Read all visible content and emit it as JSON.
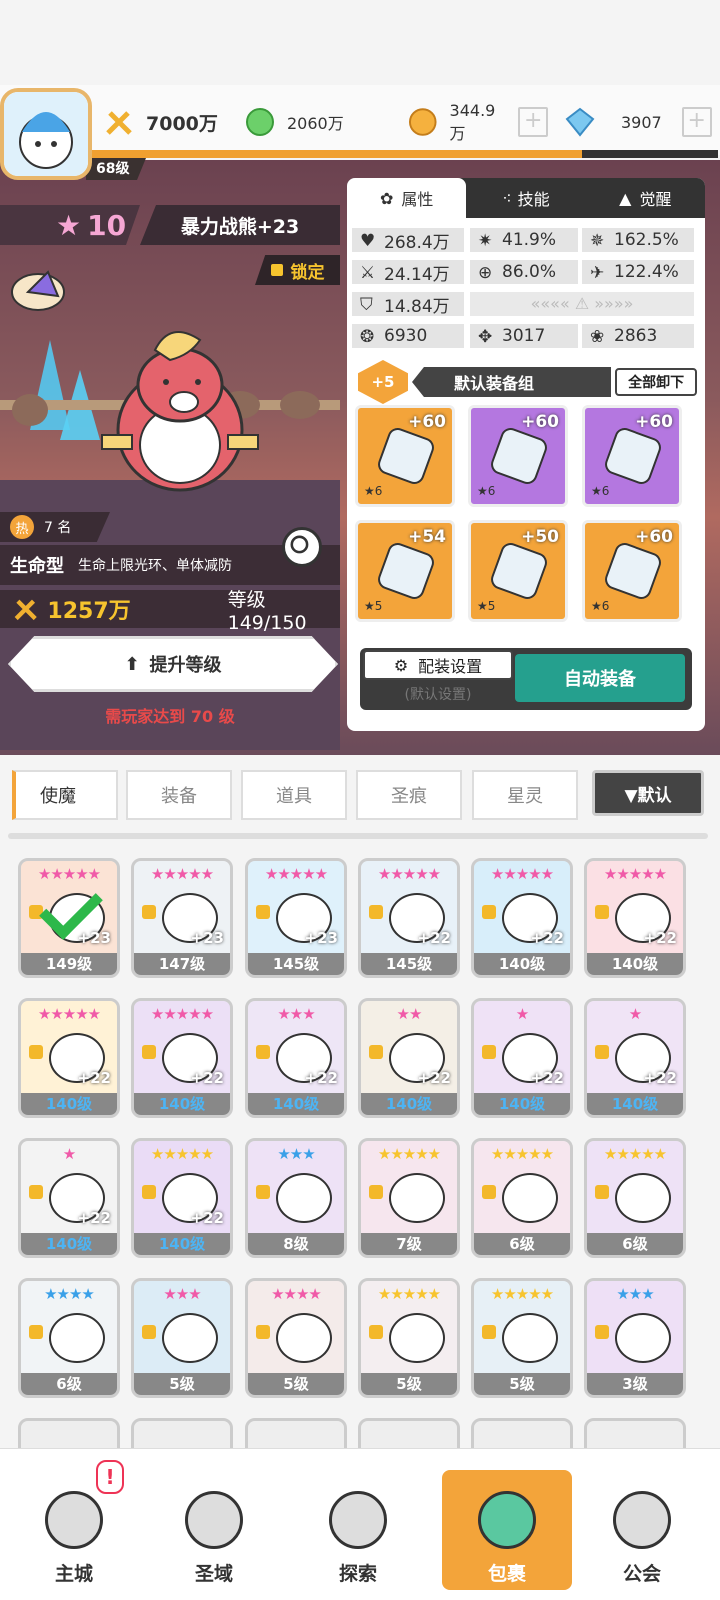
{
  "topbar": {
    "player_level": "68级",
    "power": "7000万",
    "green_currency": "2060万",
    "gold_currency": "344.9万",
    "gem_currency": "3907"
  },
  "hero": {
    "star_count": "10",
    "name": "暴力战熊+23",
    "lock_label": "锁定",
    "rank_label": "热",
    "rank_value": "7 名",
    "type": "生命型",
    "type_desc": "生命上限光环、单体减防",
    "power": "1257万",
    "level_label": "等级 149/150",
    "upgrade_button": "提升等级",
    "requirement": "需玩家达到 70 级"
  },
  "panel": {
    "tabs": [
      "属性",
      "技能",
      "觉醒"
    ],
    "stats": {
      "hp": "268.4万",
      "crit": "41.9%",
      "crit_dmg": "162.5%",
      "atk": "24.14万",
      "hit": "86.0%",
      "speed": "122.4%",
      "def": "14.84万",
      "s1": "6930",
      "s2": "3017",
      "s3": "2863"
    },
    "equip_plus": "+5",
    "equip_set": "默认装备组",
    "unload_all": "全部卸下",
    "equipment": [
      {
        "bonus": "+60",
        "star": "★6",
        "rarity": "orange",
        "icon": "sword-icon"
      },
      {
        "bonus": "+60",
        "star": "★6",
        "rarity": "purple",
        "icon": "helmet-icon"
      },
      {
        "bonus": "+60",
        "star": "★6",
        "rarity": "purple",
        "icon": "armor-icon"
      },
      {
        "bonus": "+54",
        "star": "★5",
        "rarity": "orange",
        "icon": "belt-icon"
      },
      {
        "bonus": "+50",
        "star": "★5",
        "rarity": "orange",
        "icon": "necklace-icon"
      },
      {
        "bonus": "+60",
        "star": "★6",
        "rarity": "orange",
        "icon": "boots-icon"
      }
    ],
    "config_button": "配装设置",
    "config_sub": "(默认设置)",
    "auto_button": "自动装备"
  },
  "filter_tabs": [
    "使魔",
    "装备",
    "道具",
    "圣痕",
    "星灵"
  ],
  "sort_label": "▼默认",
  "cards": [
    {
      "level": "149级",
      "plus": "+23",
      "stars": "★★★★★",
      "star_color": "#f05aa8",
      "blue": false
    },
    {
      "level": "147级",
      "plus": "+23",
      "stars": "★★★★★",
      "star_color": "#f05aa8",
      "blue": false
    },
    {
      "level": "145级",
      "plus": "+23",
      "stars": "★★★★★",
      "star_color": "#f05aa8",
      "blue": false
    },
    {
      "level": "145级",
      "plus": "+22",
      "stars": "★★★★★",
      "star_color": "#f05aa8",
      "blue": false
    },
    {
      "level": "140级",
      "plus": "+22",
      "stars": "★★★★★",
      "star_color": "#f05aa8",
      "blue": false
    },
    {
      "level": "140级",
      "plus": "+22",
      "stars": "★★★★★",
      "star_color": "#f05aa8",
      "blue": false
    },
    {
      "level": "140级",
      "plus": "+22",
      "stars": "★★★★★",
      "star_color": "#f05aa8",
      "blue": true
    },
    {
      "level": "140级",
      "plus": "+22",
      "stars": "★★★★★",
      "star_color": "#f05aa8",
      "blue": true
    },
    {
      "level": "140级",
      "plus": "+22",
      "stars": "★★★",
      "star_color": "#f05aa8",
      "blue": true
    },
    {
      "level": "140级",
      "plus": "+22",
      "stars": "★★",
      "star_color": "#f05aa8",
      "blue": true
    },
    {
      "level": "140级",
      "plus": "+22",
      "stars": "★",
      "star_color": "#f05aa8",
      "blue": true
    },
    {
      "level": "140级",
      "plus": "+22",
      "stars": "★",
      "star_color": "#f05aa8",
      "blue": true
    },
    {
      "level": "140级",
      "plus": "+22",
      "stars": "★",
      "star_color": "#f05aa8",
      "blue": true
    },
    {
      "level": "140级",
      "plus": "+22",
      "stars": "★★★★★",
      "star_color": "#f7c42e",
      "blue": true
    },
    {
      "level": "8级",
      "plus": "",
      "stars": "★★★",
      "star_color": "#3aa0e8",
      "blue": false
    },
    {
      "level": "7级",
      "plus": "",
      "stars": "★★★★★",
      "star_color": "#f7c42e",
      "blue": false
    },
    {
      "level": "6级",
      "plus": "",
      "stars": "★★★★★",
      "star_color": "#f7c42e",
      "blue": false
    },
    {
      "level": "6级",
      "plus": "",
      "stars": "★★★★★",
      "star_color": "#f7c42e",
      "blue": false
    },
    {
      "level": "6级",
      "plus": "",
      "stars": "★★★★",
      "star_color": "#3aa0e8",
      "blue": false
    },
    {
      "level": "5级",
      "plus": "",
      "stars": "★★★",
      "star_color": "#f05aa8",
      "blue": false
    },
    {
      "level": "5级",
      "plus": "",
      "stars": "★★★★",
      "star_color": "#f05aa8",
      "blue": false
    },
    {
      "level": "5级",
      "plus": "",
      "stars": "★★★★★",
      "star_color": "#f7c42e",
      "blue": false
    },
    {
      "level": "5级",
      "plus": "",
      "stars": "★★★★★",
      "star_color": "#f7c42e",
      "blue": false
    },
    {
      "level": "3级",
      "plus": "",
      "stars": "★★★",
      "star_color": "#3aa0e8",
      "blue": false
    }
  ],
  "nav": [
    "主城",
    "圣域",
    "探索",
    "包裹",
    "公会"
  ],
  "nav_badge": "!"
}
